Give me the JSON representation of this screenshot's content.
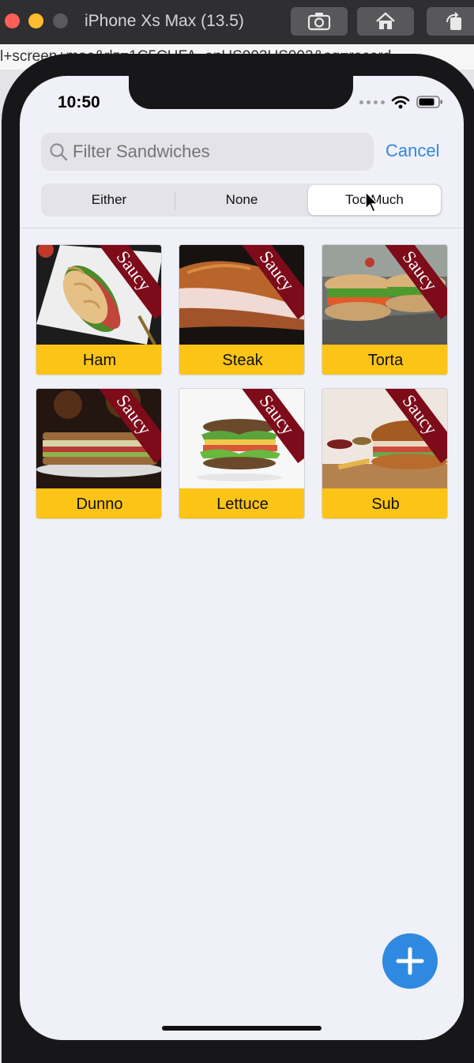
{
  "window": {
    "title": "iPhone Xs Max (13.5)",
    "url_fragment": "l+screen+mac&rlz=1C5CHFA_enUS903US903&oq=record"
  },
  "status_bar": {
    "time": "10:50"
  },
  "search": {
    "placeholder": "Filter Sandwiches",
    "cancel_label": "Cancel"
  },
  "segments": {
    "items": [
      {
        "label": "Either"
      },
      {
        "label": "None"
      },
      {
        "label": "Too Much"
      }
    ],
    "selected": "Too Much"
  },
  "sandwiches": [
    {
      "name": "Ham",
      "badge": "Saucy"
    },
    {
      "name": "Steak",
      "badge": "Saucy"
    },
    {
      "name": "Torta",
      "badge": "Saucy"
    },
    {
      "name": "Dunno",
      "badge": "Saucy"
    },
    {
      "name": "Lettuce",
      "badge": "Saucy"
    },
    {
      "name": "Sub",
      "badge": "Saucy"
    }
  ],
  "fab": {
    "icon": "plus-icon"
  },
  "colors": {
    "accent": "#2f89e0",
    "label_bg": "#fbc416",
    "ribbon": "#7d0b1a",
    "screen_bg": "#f0f0f8"
  }
}
